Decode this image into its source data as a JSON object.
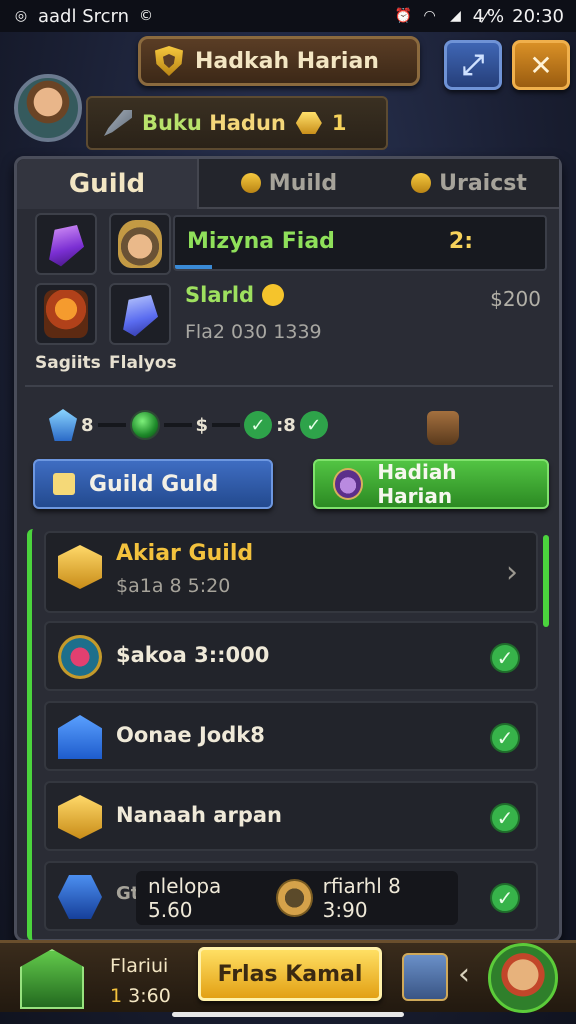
{
  "statusbar": {
    "left_text": "aadl Srcrn",
    "battery": "4⁄%",
    "time": "20:30"
  },
  "header": {
    "title": "Hadkah Harian"
  },
  "profile": {
    "name_part1": "Buku",
    "name_part2": "Hadun",
    "gold_count": "1"
  },
  "tabs": [
    {
      "label": "Guild",
      "active": true
    },
    {
      "label": "Muild",
      "active": false
    },
    {
      "label": "Uraicst",
      "active": false
    }
  ],
  "mission": {
    "label": "Mizyna Fiad",
    "value": "2:",
    "progress": 0.1
  },
  "reward": {
    "title": "Slarld",
    "sub": "Fla2 030 1339",
    "price": "$200"
  },
  "cards": {
    "left_label": "Sagiits",
    "right_label": "Flalyos"
  },
  "progress_row": {
    "val1": "8",
    "val2": "$",
    "val3": ":8"
  },
  "buttons": {
    "guild": "Guild Guld",
    "daily": "Hadiah Harian"
  },
  "list": [
    {
      "title": "Akiar Guild",
      "sub": "$a1a 8 5:20",
      "featured": true,
      "icon": "chest-icon"
    },
    {
      "title": "$akoa 3::000",
      "icon": "medal-icon"
    },
    {
      "title": "Oonae Jodk8",
      "icon": "house-icon"
    },
    {
      "title": "Nanaah arpan",
      "icon": "chest-icon"
    },
    {
      "title": "Gt",
      "banner_left": "nlelopa 5.60",
      "banner_right": "rfiarhl 8 3:90",
      "icon": "hex-icon"
    }
  ],
  "bottom": {
    "label": "Flariui",
    "sub_num": "1",
    "sub_time": "3:60",
    "button": "Frlas Kamal"
  },
  "colors": {
    "accent_green": "#4bd33d",
    "accent_gold": "#f3c23d",
    "panel_bg": "#2a2c35"
  }
}
